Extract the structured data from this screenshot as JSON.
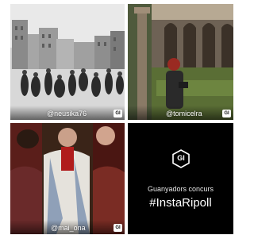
{
  "tiles": [
    {
      "handle": "@neusika76",
      "badge": "GI"
    },
    {
      "handle": "@tomicelra",
      "badge": "GI"
    },
    {
      "handle": "@mai_ona",
      "badge": "GI"
    }
  ],
  "promo": {
    "logo_text": "GI",
    "line1": "Guanyadors concurs",
    "hashtag": "#InstaRipoll"
  }
}
